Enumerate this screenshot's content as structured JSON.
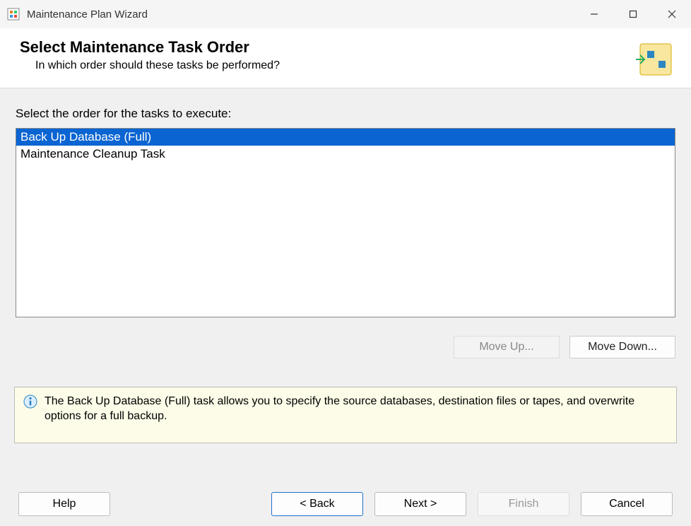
{
  "window": {
    "title": "Maintenance Plan Wizard"
  },
  "header": {
    "title": "Select Maintenance Task Order",
    "subtitle": "In which order should these tasks be performed?"
  },
  "content": {
    "instruction": "Select the order for the tasks to execute:",
    "tasks": [
      {
        "label": "Back Up Database (Full)",
        "selected": true
      },
      {
        "label": "Maintenance Cleanup Task",
        "selected": false
      }
    ],
    "move_up_label": "Move Up...",
    "move_down_label": "Move Down..."
  },
  "info": {
    "text": "The Back Up Database (Full) task allows you to specify the source databases, destination files or tapes, and overwrite options for a full backup."
  },
  "footer": {
    "help": "Help",
    "back": "< Back",
    "next": "Next >",
    "finish": "Finish",
    "cancel": "Cancel"
  }
}
